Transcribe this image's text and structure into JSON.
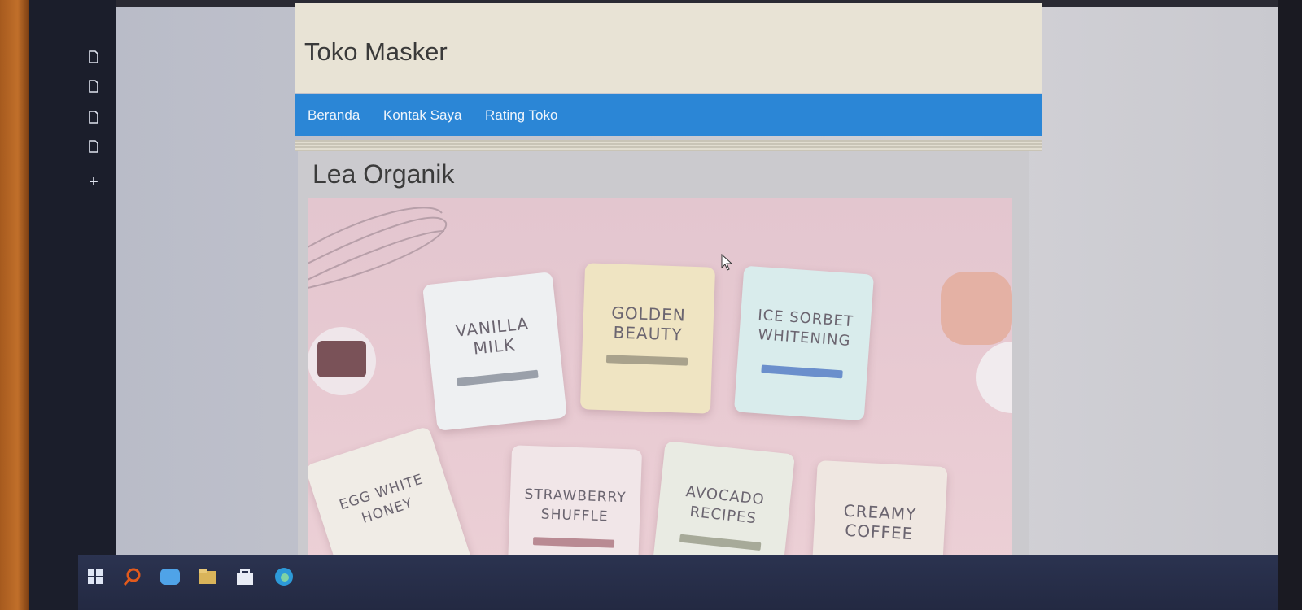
{
  "site": {
    "title": "Toko Masker",
    "nav": [
      {
        "label": "Beranda"
      },
      {
        "label": "Kontak Saya"
      },
      {
        "label": "Rating Toko"
      }
    ]
  },
  "article": {
    "title": "Lea Organik"
  },
  "hero": {
    "masks": [
      {
        "label": "VANILLA\nMILK",
        "color": "#eef0f2"
      },
      {
        "label": "GOLDEN\nBEAUTY",
        "color": "#efe4c2"
      },
      {
        "label": "ICE SORBET\nWHITENING",
        "color": "#d9ecec"
      },
      {
        "label": "EGG WHITE\nHONEY",
        "color": "#f0ece6"
      },
      {
        "label": "STRAWBERRY\nSHUFFLE",
        "color": "#f1e6e8"
      },
      {
        "label": "AVOCADO\nRECIPES",
        "color": "#e9ebe3"
      },
      {
        "label": "CREAMY\nCOFFEE",
        "color": "#efe7e1"
      }
    ]
  },
  "colors": {
    "navbar": "#2b86d6",
    "header": "#e8e3d5"
  },
  "taskbar": {
    "icons": [
      "windows-start-icon",
      "search-icon",
      "zoom-icon",
      "file-explorer-icon",
      "store-icon",
      "edge-browser-icon"
    ]
  }
}
